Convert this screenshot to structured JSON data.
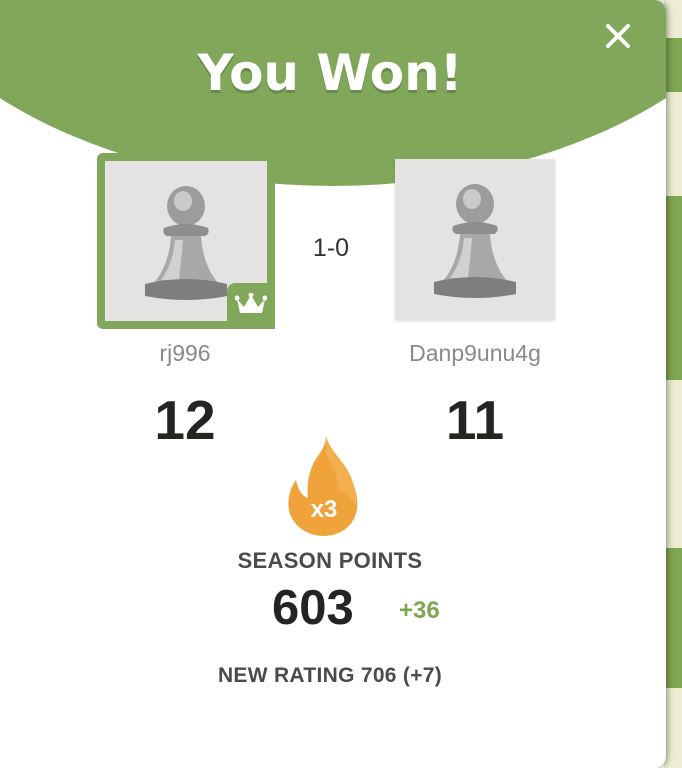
{
  "modal": {
    "title": "You Won!",
    "close_icon": "close-icon"
  },
  "result": {
    "score": "1-0"
  },
  "players": {
    "winner": {
      "username": "rj996",
      "points": "12",
      "avatar_icon": "pawn-icon",
      "badge_icon": "crown-icon"
    },
    "opponent": {
      "username": "Danp9unu4g",
      "points": "11",
      "avatar_icon": "pawn-icon"
    }
  },
  "streak": {
    "multiplier": "x3",
    "icon": "flame-icon"
  },
  "season": {
    "label": "SEASON POINTS",
    "points": "603",
    "delta": "+36"
  },
  "rating": {
    "text": "NEW RATING 706 (+7)"
  },
  "colors": {
    "accent_green": "#81a85a",
    "flame_orange": "#f0a33a",
    "delta_green": "#7fa650",
    "text_dark": "#262421"
  }
}
